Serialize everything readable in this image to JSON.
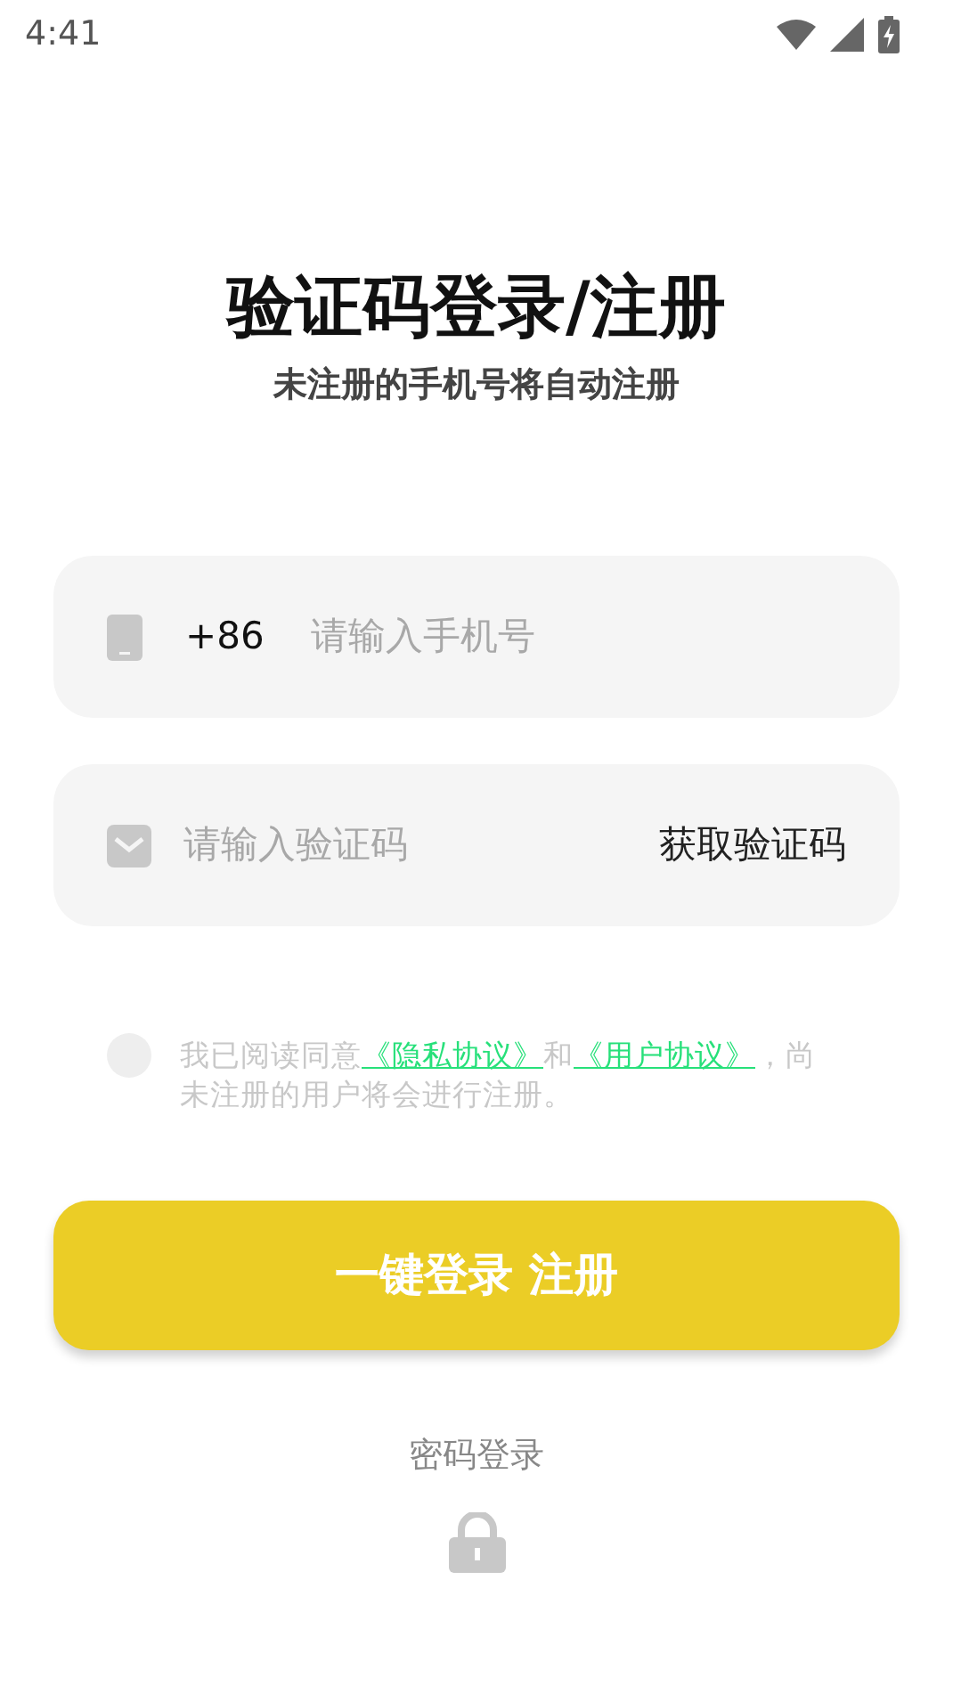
{
  "status_bar": {
    "time": "4:41"
  },
  "title": "验证码登录/注册",
  "subtitle": "未注册的手机号将自动注册",
  "phone_field": {
    "prefix": "+86",
    "placeholder": "请输入手机号"
  },
  "code_field": {
    "placeholder": "请输入验证码",
    "action": "获取验证码"
  },
  "agreement": {
    "checked": false,
    "parts": [
      {
        "kind": "text",
        "text": "我已阅读同意"
      },
      {
        "kind": "link",
        "text": "《隐私协议》"
      },
      {
        "kind": "text",
        "text": "和"
      },
      {
        "kind": "link",
        "text": "《用户协议》"
      },
      {
        "kind": "text",
        "text": "，尚未注册的用户将会进行注册。"
      }
    ]
  },
  "login_button": "一键登录 注册",
  "password_login": "密码登录"
}
